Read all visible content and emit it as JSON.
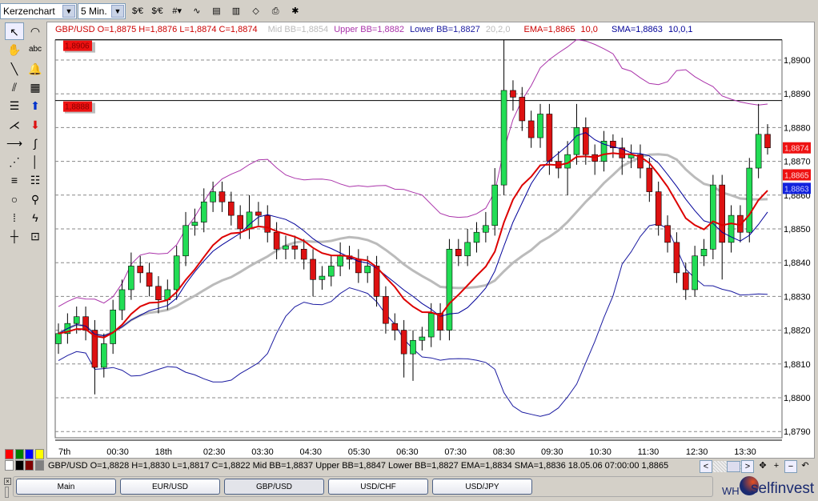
{
  "toolbar": {
    "chart_type": "Kerzenchart",
    "interval": "5 Min.",
    "icons": [
      "dollar-euro-icon",
      "dollar-euro-alt-icon",
      "grid-icon",
      "indicator-icon",
      "indicator-green-icon",
      "chart-template-icon",
      "eraser-icon",
      "print-icon",
      "settings-icon"
    ]
  },
  "tools": [
    "pointer-icon",
    "rainbow-icon",
    "hand-icon",
    "text-icon",
    "line-icon",
    "bell-icon",
    "parallel-lines-icon",
    "calculator-icon",
    "horizontal-lines-icon",
    "buy-arrow-icon",
    "fan-icon",
    "sell-arrow-icon",
    "horizontal-ray-icon",
    "wave-icon",
    "gann-fan-icon",
    "vertical-line-icon",
    "fibonacci-icon",
    "fibonacci-extension-icon",
    "circle-icon",
    "zoom-icon",
    "vertical-grid-icon",
    "lightning-icon",
    "crosshair-icon",
    "zoom-window-icon"
  ],
  "tool_text": {
    "abc": "abc"
  },
  "legend": {
    "ohlc": "GBP/USD O=1,8875 H=1,8876 L=1,8874 C=1,8874",
    "mid_bb": "Mid BB=1,8854",
    "upper_bb": "Upper BB=1,8882",
    "lower_bb": "Lower BB=1,8827",
    "bb_params": "20,2,0",
    "ema": "EMA=1,8865",
    "ema_params": "10,0",
    "sma": "SMA=1,8863",
    "sma_params": "10,0,1"
  },
  "colors": {
    "up": "#22dd55",
    "down": "#dd1111",
    "ema": "#dd0000",
    "sma": "#000099",
    "bb_band": "#aa33aa",
    "bb_lower": "#1a1aa0",
    "bb_mid": "#bbbbbb"
  },
  "swatches": [
    "#ff0000",
    "#008000",
    "#0000ff",
    "#ffff00",
    "#ffffff",
    "#000000",
    "#800000",
    "#808080"
  ],
  "status": "GBP/USD O=1,8828 H=1,8830 L=1,8817 C=1,8822  Mid BB=1,8837 Upper BB=1,8847 Lower BB=1,8827 EMA=1,8834 SMA=1,8836  18.05.06 07:00:00 1,8865",
  "nav": {
    "left": "<",
    "right": ">",
    "move": "✥",
    "plus": "+",
    "minus": "−",
    "undo": "↶"
  },
  "tabs": [
    {
      "label": "Main"
    },
    {
      "label": "EUR/USD"
    },
    {
      "label": "GBP/USD",
      "active": true
    },
    {
      "label": "USD/CHF"
    },
    {
      "label": "USD/JPY"
    }
  ],
  "logo": "WH selfinvest",
  "chart_data": {
    "type": "candlestick",
    "symbol": "GBP/USD",
    "interval": "5 Min.",
    "xticks": [
      "7th",
      "00:30",
      "18th",
      "02:30",
      "03:30",
      "04:30",
      "05:30",
      "06:30",
      "07:30",
      "08:30",
      "09:30",
      "10:30",
      "11:30",
      "12:30",
      "13:30"
    ],
    "yticks": [
      "1,8900",
      "1,8890",
      "1,8880",
      "1,8870",
      "1,8860",
      "1,8850",
      "1,8840",
      "1,8830",
      "1,8820",
      "1,8810",
      "1,8800",
      "1,8790"
    ],
    "ylim": [
      1.879,
      1.8906
    ],
    "grid": true,
    "hlines": [
      {
        "value": 1.8906,
        "label": "1,8906"
      },
      {
        "value": 1.8888,
        "label": "1,8888"
      }
    ],
    "price_tags": [
      {
        "label": "1,8874",
        "value": 1.8874,
        "color": "#ee1111"
      },
      {
        "label": "1,8865",
        "value": 1.8866,
        "color": "#ee1111"
      },
      {
        "label": "1,8863",
        "value": 1.8862,
        "color": "#1122dd"
      }
    ],
    "open": [
      1.8816,
      1.8819,
      1.8822,
      1.8824,
      1.882,
      1.8809,
      1.8816,
      1.8826,
      1.8832,
      1.8839,
      1.8837,
      1.8833,
      1.8829,
      1.8832,
      1.8842,
      1.8851,
      1.8852,
      1.8858,
      1.8861,
      1.8858,
      1.8854,
      1.885,
      1.8855,
      1.8854,
      1.8849,
      1.8844,
      1.8845,
      1.8844,
      1.8841,
      1.8835,
      1.8836,
      1.8839,
      1.8842,
      1.8841,
      1.8837,
      1.8839,
      1.883,
      1.8822,
      1.882,
      1.8813,
      1.8817,
      1.8818,
      1.8825,
      1.882,
      1.8844,
      1.8842,
      1.8846,
      1.8849,
      1.8851,
      1.8863,
      1.8891,
      1.8889,
      1.8882,
      1.8877,
      1.8884,
      1.887,
      1.8868,
      1.8872,
      1.888,
      1.8872,
      1.887,
      1.8876,
      1.8874,
      1.8871,
      1.8872,
      1.8868,
      1.8861,
      1.8851,
      1.8846,
      1.8837,
      1.8832,
      1.8842,
      1.8844,
      1.8863,
      1.8846,
      1.8854,
      1.8849,
      1.8868,
      1.8878
    ],
    "high": [
      1.8822,
      1.8825,
      1.8827,
      1.8827,
      1.8823,
      1.8819,
      1.8829,
      1.8835,
      1.8843,
      1.8842,
      1.884,
      1.8836,
      1.8835,
      1.8845,
      1.8855,
      1.8856,
      1.8862,
      1.8864,
      1.8864,
      1.8861,
      1.8857,
      1.886,
      1.8858,
      1.8857,
      1.8852,
      1.8848,
      1.8848,
      1.8847,
      1.8844,
      1.8839,
      1.8842,
      1.8846,
      1.8845,
      1.8844,
      1.8842,
      1.8842,
      1.8833,
      1.8825,
      1.8823,
      1.882,
      1.8821,
      1.8828,
      1.8828,
      1.8847,
      1.8847,
      1.885,
      1.8852,
      1.8855,
      1.8868,
      1.8906,
      1.8894,
      1.8892,
      1.8885,
      1.8887,
      1.8887,
      1.8873,
      1.8876,
      1.8887,
      1.8883,
      1.8875,
      1.8879,
      1.8878,
      1.8877,
      1.8875,
      1.8875,
      1.8871,
      1.8864,
      1.8854,
      1.8849,
      1.884,
      1.8845,
      1.8847,
      1.8866,
      1.8866,
      1.8857,
      1.8857,
      1.8871,
      1.8887,
      1.8881
    ],
    "low": [
      1.8813,
      1.8816,
      1.8819,
      1.8817,
      1.8801,
      1.8806,
      1.8813,
      1.8823,
      1.8829,
      1.8834,
      1.883,
      1.8825,
      1.8826,
      1.8829,
      1.8839,
      1.8848,
      1.8849,
      1.8855,
      1.8855,
      1.8851,
      1.8847,
      1.8847,
      1.8851,
      1.8846,
      1.8841,
      1.8841,
      1.8841,
      1.8838,
      1.883,
      1.8832,
      1.8833,
      1.8836,
      1.8838,
      1.8834,
      1.8834,
      1.8827,
      1.8819,
      1.8817,
      1.8806,
      1.8805,
      1.8814,
      1.8815,
      1.8817,
      1.8817,
      1.8839,
      1.8839,
      1.8843,
      1.8846,
      1.8848,
      1.886,
      1.8885,
      1.8879,
      1.8874,
      1.8874,
      1.8866,
      1.8865,
      1.886,
      1.8869,
      1.8869,
      1.8866,
      1.8867,
      1.8871,
      1.8866,
      1.8868,
      1.8865,
      1.8858,
      1.8848,
      1.8843,
      1.8834,
      1.8829,
      1.883,
      1.8839,
      1.8841,
      1.8835,
      1.8843,
      1.8846,
      1.8846,
      1.8865,
      1.8872
    ],
    "close": [
      1.8819,
      1.8822,
      1.8824,
      1.882,
      1.8809,
      1.8816,
      1.8826,
      1.8832,
      1.8839,
      1.8837,
      1.8833,
      1.8829,
      1.8832,
      1.8842,
      1.8851,
      1.8852,
      1.8858,
      1.8861,
      1.8858,
      1.8854,
      1.885,
      1.8855,
      1.8854,
      1.8849,
      1.8844,
      1.8845,
      1.8844,
      1.8841,
      1.8835,
      1.8836,
      1.8839,
      1.8842,
      1.8841,
      1.8837,
      1.8839,
      1.883,
      1.8822,
      1.882,
      1.8813,
      1.8817,
      1.8818,
      1.8825,
      1.882,
      1.8844,
      1.8842,
      1.8846,
      1.8849,
      1.8851,
      1.8863,
      1.8891,
      1.8889,
      1.8882,
      1.8877,
      1.8884,
      1.887,
      1.8868,
      1.8872,
      1.888,
      1.8872,
      1.887,
      1.8876,
      1.8874,
      1.8871,
      1.8872,
      1.8868,
      1.8861,
      1.8851,
      1.8846,
      1.8837,
      1.8832,
      1.8842,
      1.8844,
      1.8863,
      1.8846,
      1.8854,
      1.8849,
      1.8868,
      1.8878,
      1.8874
    ],
    "indicators": [
      "Bollinger Bands 20,2,0",
      "EMA 10,0",
      "SMA 10,0,1"
    ]
  }
}
